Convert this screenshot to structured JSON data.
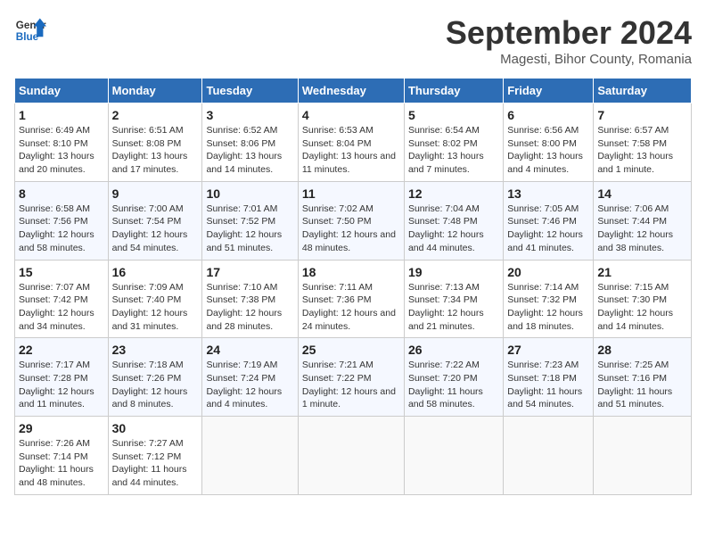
{
  "logo": {
    "line1": "General",
    "line2": "Blue"
  },
  "title": "September 2024",
  "subtitle": "Magesti, Bihor County, Romania",
  "days_of_week": [
    "Sunday",
    "Monday",
    "Tuesday",
    "Wednesday",
    "Thursday",
    "Friday",
    "Saturday"
  ],
  "weeks": [
    [
      {
        "day": "1",
        "sunrise": "Sunrise: 6:49 AM",
        "sunset": "Sunset: 8:10 PM",
        "daylight": "Daylight: 13 hours and 20 minutes."
      },
      {
        "day": "2",
        "sunrise": "Sunrise: 6:51 AM",
        "sunset": "Sunset: 8:08 PM",
        "daylight": "Daylight: 13 hours and 17 minutes."
      },
      {
        "day": "3",
        "sunrise": "Sunrise: 6:52 AM",
        "sunset": "Sunset: 8:06 PM",
        "daylight": "Daylight: 13 hours and 14 minutes."
      },
      {
        "day": "4",
        "sunrise": "Sunrise: 6:53 AM",
        "sunset": "Sunset: 8:04 PM",
        "daylight": "Daylight: 13 hours and 11 minutes."
      },
      {
        "day": "5",
        "sunrise": "Sunrise: 6:54 AM",
        "sunset": "Sunset: 8:02 PM",
        "daylight": "Daylight: 13 hours and 7 minutes."
      },
      {
        "day": "6",
        "sunrise": "Sunrise: 6:56 AM",
        "sunset": "Sunset: 8:00 PM",
        "daylight": "Daylight: 13 hours and 4 minutes."
      },
      {
        "day": "7",
        "sunrise": "Sunrise: 6:57 AM",
        "sunset": "Sunset: 7:58 PM",
        "daylight": "Daylight: 13 hours and 1 minute."
      }
    ],
    [
      {
        "day": "8",
        "sunrise": "Sunrise: 6:58 AM",
        "sunset": "Sunset: 7:56 PM",
        "daylight": "Daylight: 12 hours and 58 minutes."
      },
      {
        "day": "9",
        "sunrise": "Sunrise: 7:00 AM",
        "sunset": "Sunset: 7:54 PM",
        "daylight": "Daylight: 12 hours and 54 minutes."
      },
      {
        "day": "10",
        "sunrise": "Sunrise: 7:01 AM",
        "sunset": "Sunset: 7:52 PM",
        "daylight": "Daylight: 12 hours and 51 minutes."
      },
      {
        "day": "11",
        "sunrise": "Sunrise: 7:02 AM",
        "sunset": "Sunset: 7:50 PM",
        "daylight": "Daylight: 12 hours and 48 minutes."
      },
      {
        "day": "12",
        "sunrise": "Sunrise: 7:04 AM",
        "sunset": "Sunset: 7:48 PM",
        "daylight": "Daylight: 12 hours and 44 minutes."
      },
      {
        "day": "13",
        "sunrise": "Sunrise: 7:05 AM",
        "sunset": "Sunset: 7:46 PM",
        "daylight": "Daylight: 12 hours and 41 minutes."
      },
      {
        "day": "14",
        "sunrise": "Sunrise: 7:06 AM",
        "sunset": "Sunset: 7:44 PM",
        "daylight": "Daylight: 12 hours and 38 minutes."
      }
    ],
    [
      {
        "day": "15",
        "sunrise": "Sunrise: 7:07 AM",
        "sunset": "Sunset: 7:42 PM",
        "daylight": "Daylight: 12 hours and 34 minutes."
      },
      {
        "day": "16",
        "sunrise": "Sunrise: 7:09 AM",
        "sunset": "Sunset: 7:40 PM",
        "daylight": "Daylight: 12 hours and 31 minutes."
      },
      {
        "day": "17",
        "sunrise": "Sunrise: 7:10 AM",
        "sunset": "Sunset: 7:38 PM",
        "daylight": "Daylight: 12 hours and 28 minutes."
      },
      {
        "day": "18",
        "sunrise": "Sunrise: 7:11 AM",
        "sunset": "Sunset: 7:36 PM",
        "daylight": "Daylight: 12 hours and 24 minutes."
      },
      {
        "day": "19",
        "sunrise": "Sunrise: 7:13 AM",
        "sunset": "Sunset: 7:34 PM",
        "daylight": "Daylight: 12 hours and 21 minutes."
      },
      {
        "day": "20",
        "sunrise": "Sunrise: 7:14 AM",
        "sunset": "Sunset: 7:32 PM",
        "daylight": "Daylight: 12 hours and 18 minutes."
      },
      {
        "day": "21",
        "sunrise": "Sunrise: 7:15 AM",
        "sunset": "Sunset: 7:30 PM",
        "daylight": "Daylight: 12 hours and 14 minutes."
      }
    ],
    [
      {
        "day": "22",
        "sunrise": "Sunrise: 7:17 AM",
        "sunset": "Sunset: 7:28 PM",
        "daylight": "Daylight: 12 hours and 11 minutes."
      },
      {
        "day": "23",
        "sunrise": "Sunrise: 7:18 AM",
        "sunset": "Sunset: 7:26 PM",
        "daylight": "Daylight: 12 hours and 8 minutes."
      },
      {
        "day": "24",
        "sunrise": "Sunrise: 7:19 AM",
        "sunset": "Sunset: 7:24 PM",
        "daylight": "Daylight: 12 hours and 4 minutes."
      },
      {
        "day": "25",
        "sunrise": "Sunrise: 7:21 AM",
        "sunset": "Sunset: 7:22 PM",
        "daylight": "Daylight: 12 hours and 1 minute."
      },
      {
        "day": "26",
        "sunrise": "Sunrise: 7:22 AM",
        "sunset": "Sunset: 7:20 PM",
        "daylight": "Daylight: 11 hours and 58 minutes."
      },
      {
        "day": "27",
        "sunrise": "Sunrise: 7:23 AM",
        "sunset": "Sunset: 7:18 PM",
        "daylight": "Daylight: 11 hours and 54 minutes."
      },
      {
        "day": "28",
        "sunrise": "Sunrise: 7:25 AM",
        "sunset": "Sunset: 7:16 PM",
        "daylight": "Daylight: 11 hours and 51 minutes."
      }
    ],
    [
      {
        "day": "29",
        "sunrise": "Sunrise: 7:26 AM",
        "sunset": "Sunset: 7:14 PM",
        "daylight": "Daylight: 11 hours and 48 minutes."
      },
      {
        "day": "30",
        "sunrise": "Sunrise: 7:27 AM",
        "sunset": "Sunset: 7:12 PM",
        "daylight": "Daylight: 11 hours and 44 minutes."
      },
      null,
      null,
      null,
      null,
      null
    ]
  ]
}
